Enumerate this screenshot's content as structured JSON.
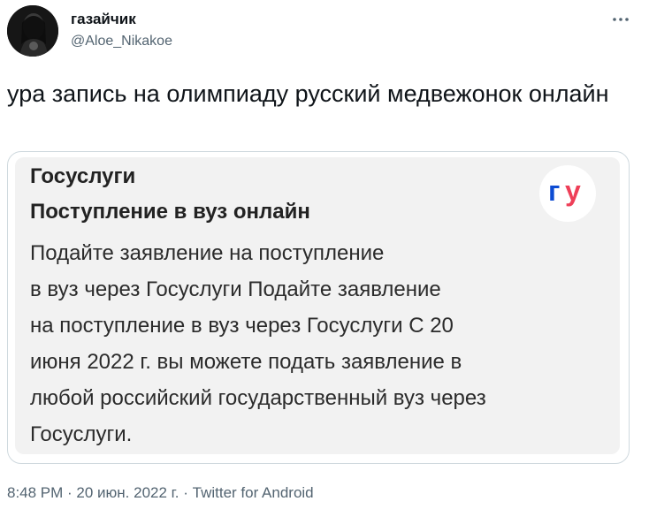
{
  "tweet": {
    "author_name": "газайчик",
    "author_handle": "@Aloe_Nikakoe",
    "text": "ура запись на олимпиаду русский медвежонок онлайн",
    "more_icon": "more-dots-icon",
    "timestamp": "8:48 PM · 20 июн. 2022 г. · Twitter for Android"
  },
  "card": {
    "site": "Госуслуги",
    "title": "Поступление в вуз онлайн",
    "body_lines": [
      "Подайте заявление на поступление",
      "в вуз через Госуслуги Подайте заявление",
      "на поступление в вуз через Госуслуги С 20",
      "июня 2022 г. вы можете подать заявление в",
      "любой российский государственный вуз через",
      "Госуслуги."
    ],
    "logo_text": "гу",
    "logo_colors": {
      "blue": "#0d4cd3",
      "red": "#ee3f58"
    }
  }
}
